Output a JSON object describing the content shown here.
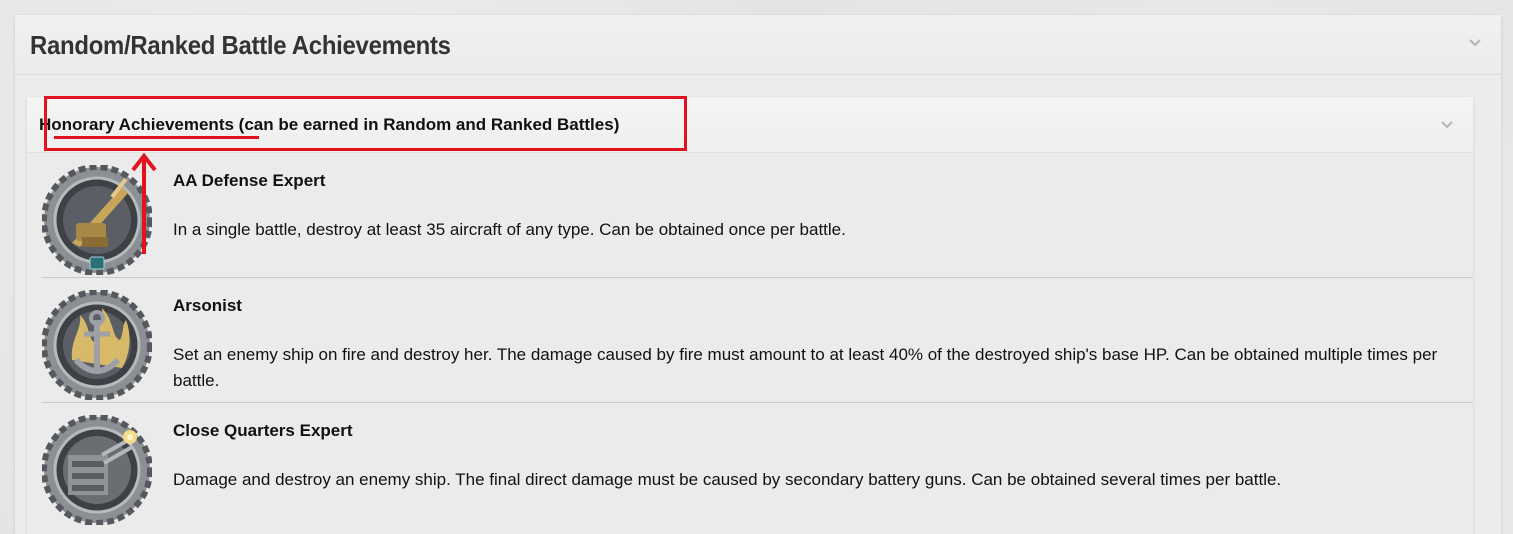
{
  "section": {
    "title": "Random/Ranked Battle Achievements"
  },
  "subsection": {
    "title_highlight": "Honorary Achievements",
    "title_rest": " (can be earned in Random and Ranked Battles)"
  },
  "achievements": [
    {
      "name": "AA Defense Expert",
      "description": "In a single battle, destroy at least 35 aircraft of any type. Can be obtained once per battle.",
      "icon": "aa-gun-medal-icon"
    },
    {
      "name": "Arsonist",
      "description": "Set an enemy ship on fire and destroy her. The damage caused by fire must amount to at least 40% of the destroyed ship's base HP. Can be obtained multiple times per battle.",
      "icon": "anchor-fire-medal-icon"
    },
    {
      "name": "Close Quarters Expert",
      "description": "Damage and destroy an enemy ship. The final direct damage must be caused by secondary battery guns. Can be obtained several times per battle.",
      "icon": "secondary-guns-medal-icon"
    }
  ],
  "colors": {
    "annotation": "#e0141e",
    "medal_gold": "#c9a55a",
    "medal_steel": "#6f7378"
  }
}
